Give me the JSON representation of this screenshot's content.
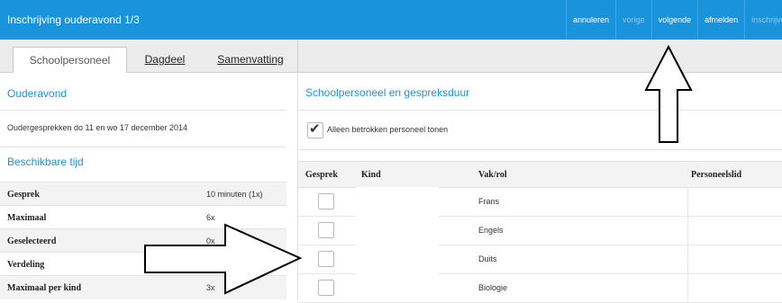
{
  "app": {
    "title": "Inschrijving ouderavond 1/3"
  },
  "topnav": [
    {
      "label": "annuleren",
      "disabled": false
    },
    {
      "label": "vorige",
      "disabled": true
    },
    {
      "label": "volgende",
      "disabled": false
    },
    {
      "label": "afmelden",
      "disabled": false
    },
    {
      "label": "inschrijven",
      "disabled": true
    }
  ],
  "tabs": [
    {
      "label": "Schoolpersoneel",
      "active": true
    },
    {
      "label": "Dagdeel",
      "active": false
    },
    {
      "label": "Samenvatting",
      "active": false
    }
  ],
  "left": {
    "ouderavond_title": "Ouderavond",
    "ouderavond_text": "Oudergesprekken do 11 en wo 17 december 2014",
    "tijd_title": "Beschikbare tijd",
    "rows": [
      {
        "label": "Gesprek",
        "value": "10 minuten (1x)"
      },
      {
        "label": "Maximaal",
        "value": "6x"
      },
      {
        "label": "Geselecteerd",
        "value": "0x"
      },
      {
        "label": "Verdeling",
        "value": ""
      },
      {
        "label": "Maximaal per kind",
        "value": "3x"
      }
    ]
  },
  "right": {
    "title": "Schoolpersoneel en gespreksduur",
    "filter_label": "Alleen betrokken personeel tonen",
    "filter_checked": true,
    "columns": {
      "gesprek": "Gesprek",
      "kind": "Kind",
      "vak": "Vak/rol",
      "personeelslid": "Personeelslid"
    },
    "rows": [
      {
        "vak": "Frans"
      },
      {
        "vak": "Engels"
      },
      {
        "vak": "Duits"
      },
      {
        "vak": "Biologie"
      }
    ]
  },
  "colors": {
    "topbar": "#1a93dd",
    "accent": "#1a93dd"
  }
}
